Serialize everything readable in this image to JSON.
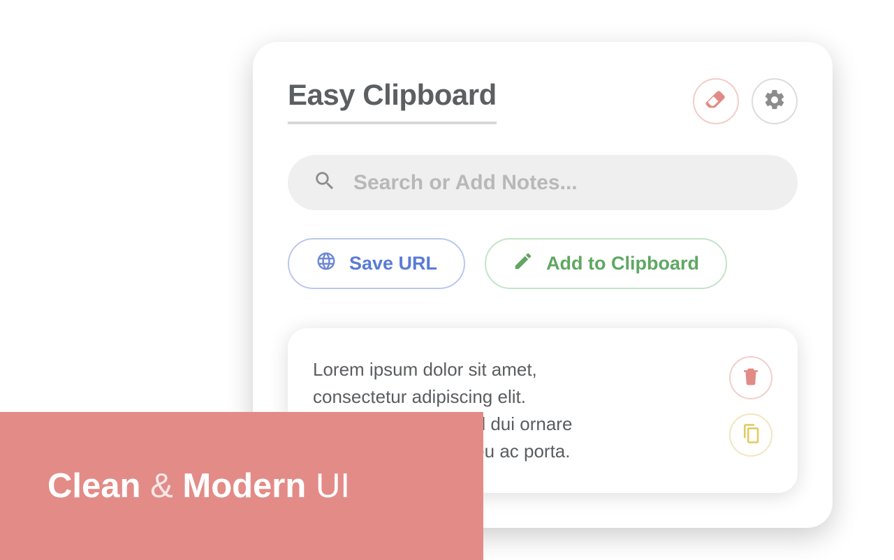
{
  "header": {
    "title": "Easy Clipboard"
  },
  "search": {
    "placeholder": "Search or Add Notes..."
  },
  "actions": {
    "save_url": "Save URL",
    "add_clipboard": "Add to Clipboard"
  },
  "note": {
    "text": "Lorem ipsum dolor sit amet,\nconsectetur adipiscing elit.\nCurabitur placerat vel dui ornare\nvarius. Morbi lectus eu ac porta."
  },
  "banner": {
    "word1": "Clean",
    "amp": "&",
    "word2": "Modern",
    "word3": "UI"
  },
  "icons": {
    "erase": "erase-icon",
    "settings": "gear-icon",
    "search": "search-icon",
    "globe": "globe-icon",
    "pencil": "pencil-icon",
    "trash": "trash-icon",
    "copy": "copy-icon"
  }
}
